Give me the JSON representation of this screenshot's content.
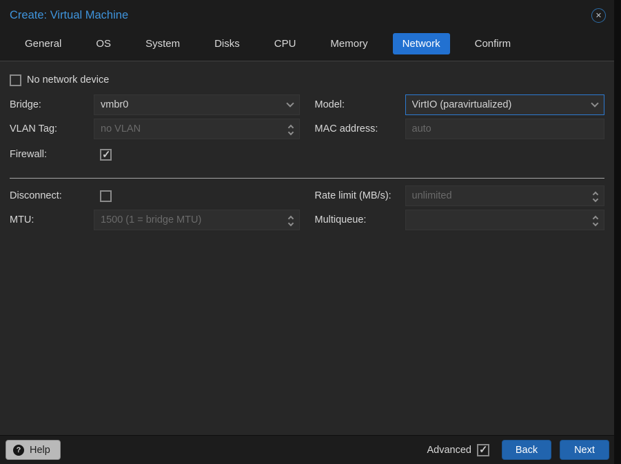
{
  "dialog": {
    "title": "Create: Virtual Machine"
  },
  "tabs": [
    {
      "label": "General",
      "active": false
    },
    {
      "label": "OS",
      "active": false
    },
    {
      "label": "System",
      "active": false
    },
    {
      "label": "Disks",
      "active": false
    },
    {
      "label": "CPU",
      "active": false
    },
    {
      "label": "Memory",
      "active": false
    },
    {
      "label": "Network",
      "active": true
    },
    {
      "label": "Confirm",
      "active": false
    }
  ],
  "form": {
    "no_network_device": {
      "label": "No network device",
      "checked": false
    },
    "bridge": {
      "label": "Bridge:",
      "value": "vmbr0"
    },
    "model": {
      "label": "Model:",
      "value": "VirtIO (paravirtualized)"
    },
    "vlan_tag": {
      "label": "VLAN Tag:",
      "placeholder": "no VLAN"
    },
    "mac_address": {
      "label": "MAC address:",
      "placeholder": "auto"
    },
    "firewall": {
      "label": "Firewall:",
      "checked": true
    },
    "disconnect": {
      "label": "Disconnect:",
      "checked": false
    },
    "rate_limit": {
      "label": "Rate limit (MB/s):",
      "placeholder": "unlimited"
    },
    "mtu": {
      "label": "MTU:",
      "placeholder": "1500 (1 = bridge MTU)"
    },
    "multiqueue": {
      "label": "Multiqueue:",
      "placeholder": ""
    }
  },
  "footer": {
    "help_label": "Help",
    "advanced": {
      "label": "Advanced",
      "checked": true
    },
    "back_label": "Back",
    "next_label": "Next"
  },
  "colors": {
    "accent_tab": "#2271d1",
    "title_blue": "#3f94dc",
    "button_blue": "#2164ae",
    "focus_border": "#2d7ad1"
  }
}
